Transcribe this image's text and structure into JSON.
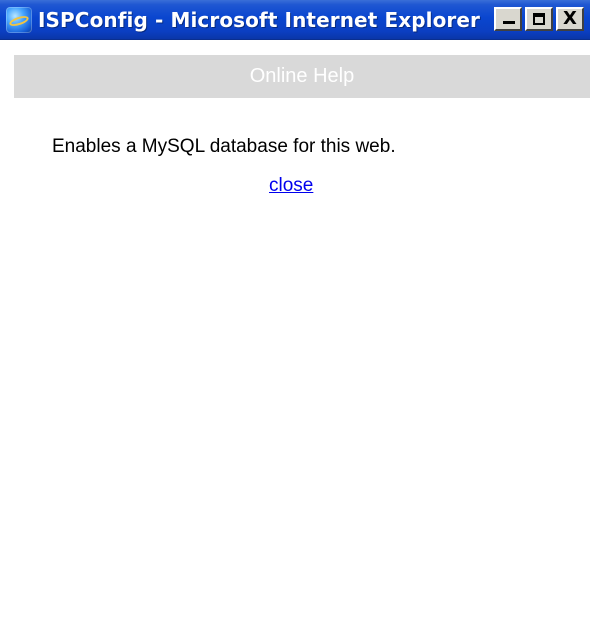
{
  "window": {
    "title": "ISPConfig - Microsoft Internet Explorer",
    "controls": {
      "minimize_icon": "minimize-icon",
      "maximize_icon": "maximize-icon",
      "close_glyph": "X"
    }
  },
  "help": {
    "header": "Online Help",
    "description": "Enables a MySQL database for this web.",
    "close_link": "close"
  },
  "colors": {
    "titlebar": "#0A46CF",
    "header_bar": "#D9D9D9",
    "link": "#0000EE"
  }
}
